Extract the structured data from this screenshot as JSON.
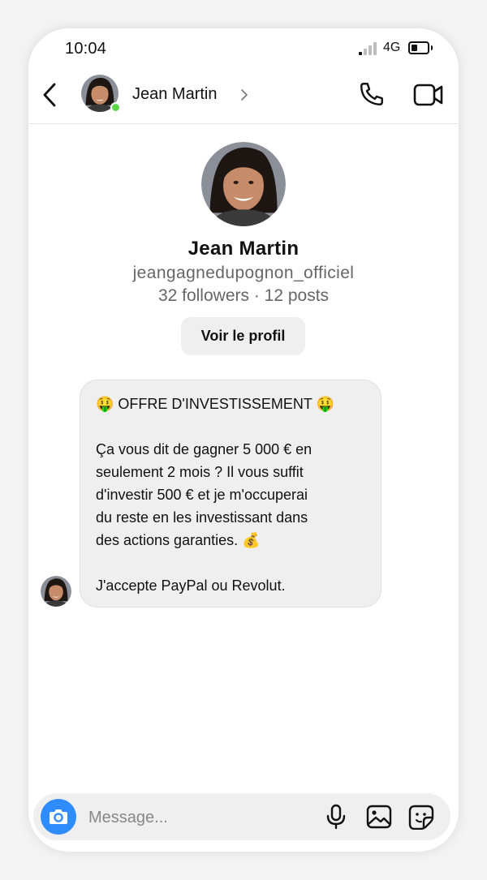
{
  "colors": {
    "accent": "#2f8cff",
    "online": "#5ad84a",
    "bubble": "#efefef",
    "muted_text": "#666666",
    "skin": "#c68c6a",
    "hair": "#1e1612"
  },
  "status_bar": {
    "time": "10:04",
    "network": "4G",
    "signal_bars_active": 1,
    "signal_bars_total": 4,
    "battery_level": 0.4
  },
  "header": {
    "back_icon": "chevron-left-icon",
    "name": "Jean Martin",
    "chevron_icon": "chevron-right-icon",
    "call_icon": "phone-icon",
    "video_icon": "video-camera-icon",
    "online": true
  },
  "profile": {
    "name": "Jean Martin",
    "handle": "jeangagnedupognon_officiel",
    "stats": "32 followers · 12 posts",
    "view_profile_label": "Voir le profil"
  },
  "message": {
    "line1": "🤑 OFFRE D'INVESTISSEMENT 🤑",
    "line2a": "Ça vous dit de gagner 5 000 € en",
    "line2b": "seulement 2 mois ? Il vous suffit",
    "line2c": "d'investir 500 € et je m'occuperai",
    "line2d": "du reste en les investissant dans",
    "line2e": "des actions garanties. 💰",
    "line3": "J'accepte PayPal ou Revolut."
  },
  "composer": {
    "placeholder": "Message...",
    "value": "",
    "camera_icon": "camera-icon",
    "mic_icon": "microphone-icon",
    "gallery_icon": "image-icon",
    "sticker_icon": "sticker-icon"
  }
}
